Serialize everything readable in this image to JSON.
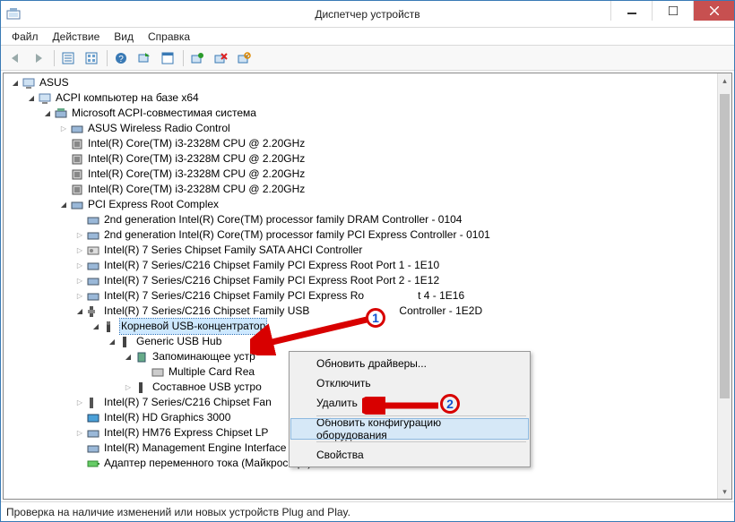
{
  "window": {
    "title": "Диспетчер устройств"
  },
  "menubar": {
    "file": "Файл",
    "action": "Действие",
    "view": "Вид",
    "help": "Справка"
  },
  "tree": {
    "root": "ASUS",
    "acpi": "ACPI компьютер на базе x64",
    "msacpi": "Microsoft ACPI-совместимая система",
    "wireless": "ASUS Wireless Radio Control",
    "cpu": "Intel(R) Core(TM) i3-2328M CPU @ 2.20GHz",
    "pcicomplex": "PCI Express Root Complex",
    "dram": "2nd generation Intel(R) Core(TM) processor family DRAM Controller - 0104",
    "pci0101": "2nd generation Intel(R) Core(TM) processor family PCI Express Controller - 0101",
    "sata": "Intel(R) 7 Series Chipset Family SATA AHCI Controller",
    "pcie10": "Intel(R) 7 Series/C216 Chipset Family PCI Express Root Port 1 - 1E10",
    "pcie12": "Intel(R) 7 Series/C216 Chipset Family PCI Express Root Port 2 - 1E12",
    "pcie16_a": "Intel(R) 7 Series/C216 Chipset Family PCI Express Ro",
    "pcie16_b": "t 4 - 1E16",
    "usb2d_a": "Intel(R) 7 Series/C216 Chipset Family USB",
    "usb2d_b": "Controller - 1E2D",
    "rootusb": "Корневой USB-концентратор",
    "genhub": "Generic USB Hub",
    "storage": "Запоминающее устр",
    "multicard": "Multiple Card  Rea",
    "composite": "Составное USB устро",
    "usb26": "Intel(R) 7 Series/C216 Chipset Fan",
    "hd3000": "Intel(R) HD Graphics 3000",
    "hm76": "Intel(R) HM76 Express Chipset LP",
    "mei": "Intel(R) Management Engine Interface",
    "acadapter": "Адаптер переменного тока (Майкрософт)"
  },
  "context": {
    "update_drivers": "Обновить драйверы...",
    "disable": "Отключить",
    "delete": "Удалить",
    "scan_hw": "Обновить конфигурацию оборудования",
    "properties": "Свойства"
  },
  "status": "Проверка на наличие изменений или новых устройств Plug and Play.",
  "annotations": {
    "num1": "1",
    "num2": "2"
  }
}
